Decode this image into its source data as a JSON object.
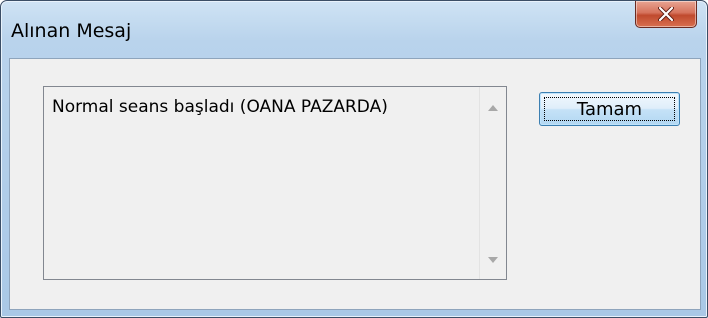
{
  "window": {
    "title": "Alınan Mesaj",
    "close_glyph": "X",
    "close_icon": "close-icon"
  },
  "message": {
    "text": "Normal seans başladı (OANA PAZARDA)",
    "scroll_up_icon": "scroll-up-arrow-icon",
    "scroll_down_icon": "scroll-down-arrow-icon"
  },
  "buttons": {
    "ok_label": "Tamam"
  },
  "colors": {
    "titlebar": "#b9d3ec",
    "close_button": "#c04a2e",
    "client_background": "#f0f0f0",
    "button_border": "#3c7fb1"
  }
}
